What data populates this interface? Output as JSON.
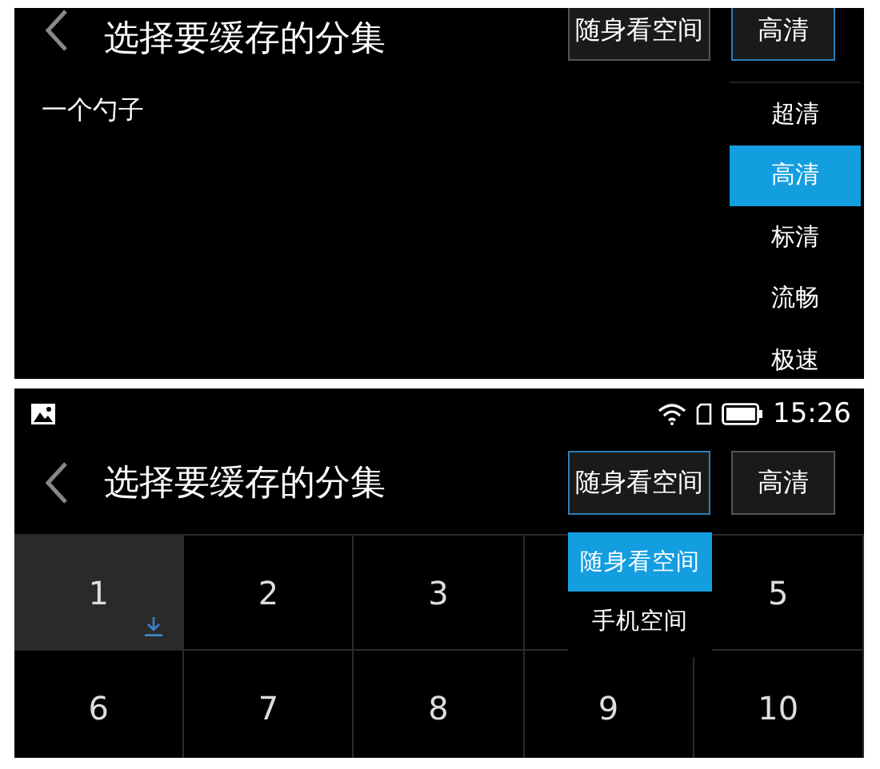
{
  "screens": [
    {
      "kind": "list",
      "header": {
        "title": "选择要缓存的分集",
        "buttons": [
          {
            "label": "随身看空间",
            "active": false
          },
          {
            "label": "高清",
            "active": true
          }
        ]
      },
      "items": [
        "一个勺子"
      ],
      "quality_menu": [
        {
          "label": "超清",
          "selected": false
        },
        {
          "label": "高清",
          "selected": true
        },
        {
          "label": "标清",
          "selected": false
        },
        {
          "label": "流畅",
          "selected": false
        },
        {
          "label": "极速",
          "selected": false
        }
      ]
    },
    {
      "kind": "grid",
      "status_bar": {
        "time": "15:26"
      },
      "header": {
        "title": "选择要缓存的分集",
        "buttons": [
          {
            "label": "随身看空间",
            "active": true
          },
          {
            "label": "高清",
            "active": false
          }
        ]
      },
      "episodes": [
        {
          "label": "1",
          "selected": true,
          "downloaded": true
        },
        {
          "label": "2",
          "selected": false,
          "downloaded": false
        },
        {
          "label": "3",
          "selected": false,
          "downloaded": false
        },
        {
          "selected": false,
          "downloaded": false
        },
        {
          "label": "5",
          "selected": false,
          "downloaded": false
        },
        {
          "label": "6",
          "selected": false,
          "downloaded": false
        },
        {
          "label": "7",
          "selected": false,
          "downloaded": false
        },
        {
          "label": "8",
          "selected": false,
          "downloaded": false
        },
        {
          "label": "9",
          "selected": false,
          "downloaded": false
        },
        {
          "label": "10",
          "selected": false,
          "downloaded": false
        }
      ],
      "storage_menu": [
        {
          "label": "随身看空间",
          "selected": true
        },
        {
          "label": "手机空间",
          "selected": false
        }
      ]
    }
  ]
}
